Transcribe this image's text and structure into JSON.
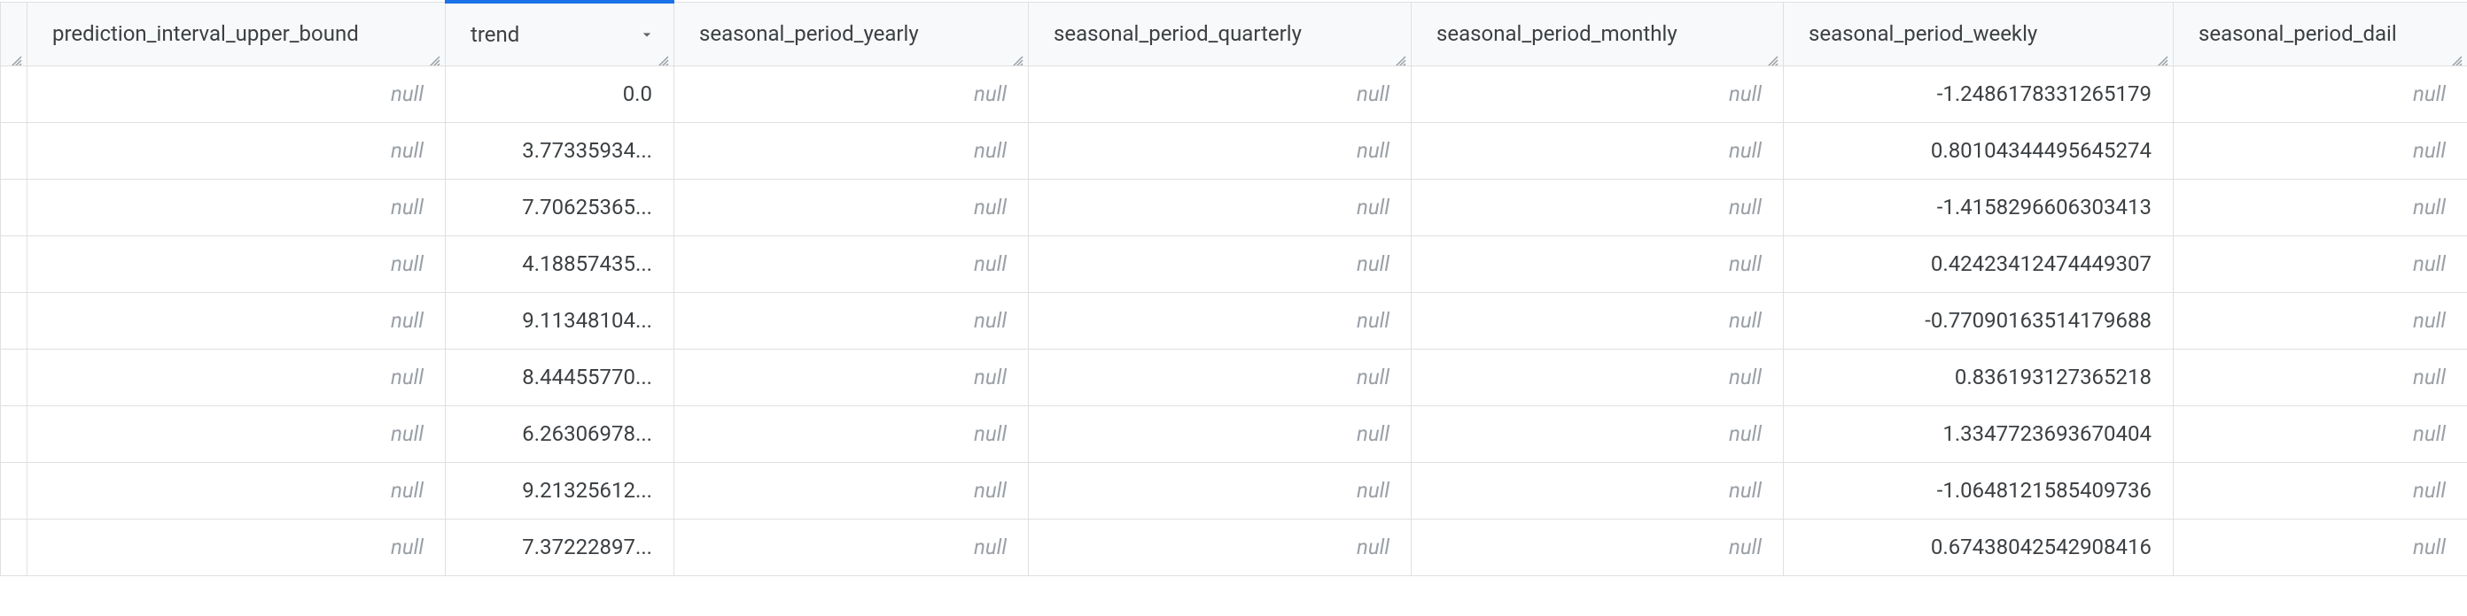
{
  "null_text": "null",
  "columns": [
    {
      "key": "prediction_interval_upper_bound",
      "label": "prediction_interval_upper_bound",
      "sorted": false
    },
    {
      "key": "trend",
      "label": "trend",
      "sorted": true,
      "sort_dir": "desc"
    },
    {
      "key": "seasonal_period_yearly",
      "label": "seasonal_period_yearly",
      "sorted": false
    },
    {
      "key": "seasonal_period_quarterly",
      "label": "seasonal_period_quarterly",
      "sorted": false
    },
    {
      "key": "seasonal_period_monthly",
      "label": "seasonal_period_monthly",
      "sorted": false
    },
    {
      "key": "seasonal_period_weekly",
      "label": "seasonal_period_weekly",
      "sorted": false
    },
    {
      "key": "seasonal_period_daily",
      "label": "seasonal_period_dail",
      "sorted": false
    }
  ],
  "rows": [
    {
      "prediction_interval_upper_bound": null,
      "trend": "0.0",
      "seasonal_period_yearly": null,
      "seasonal_period_quarterly": null,
      "seasonal_period_monthly": null,
      "seasonal_period_weekly": "-1.2486178331265179",
      "seasonal_period_daily": null
    },
    {
      "prediction_interval_upper_bound": null,
      "trend": "3.77335934...",
      "seasonal_period_yearly": null,
      "seasonal_period_quarterly": null,
      "seasonal_period_monthly": null,
      "seasonal_period_weekly": "0.80104344495645274",
      "seasonal_period_daily": null
    },
    {
      "prediction_interval_upper_bound": null,
      "trend": "7.70625365...",
      "seasonal_period_yearly": null,
      "seasonal_period_quarterly": null,
      "seasonal_period_monthly": null,
      "seasonal_period_weekly": "-1.4158296606303413",
      "seasonal_period_daily": null
    },
    {
      "prediction_interval_upper_bound": null,
      "trend": "4.18857435...",
      "seasonal_period_yearly": null,
      "seasonal_period_quarterly": null,
      "seasonal_period_monthly": null,
      "seasonal_period_weekly": "0.42423412474449307",
      "seasonal_period_daily": null
    },
    {
      "prediction_interval_upper_bound": null,
      "trend": "9.11348104...",
      "seasonal_period_yearly": null,
      "seasonal_period_quarterly": null,
      "seasonal_period_monthly": null,
      "seasonal_period_weekly": "-0.77090163514179688",
      "seasonal_period_daily": null
    },
    {
      "prediction_interval_upper_bound": null,
      "trend": "8.44455770...",
      "seasonal_period_yearly": null,
      "seasonal_period_quarterly": null,
      "seasonal_period_monthly": null,
      "seasonal_period_weekly": "0.836193127365218",
      "seasonal_period_daily": null
    },
    {
      "prediction_interval_upper_bound": null,
      "trend": "6.26306978...",
      "seasonal_period_yearly": null,
      "seasonal_period_quarterly": null,
      "seasonal_period_monthly": null,
      "seasonal_period_weekly": "1.3347723693670404",
      "seasonal_period_daily": null
    },
    {
      "prediction_interval_upper_bound": null,
      "trend": "9.21325612...",
      "seasonal_period_yearly": null,
      "seasonal_period_quarterly": null,
      "seasonal_period_monthly": null,
      "seasonal_period_weekly": "-1.0648121585409736",
      "seasonal_period_daily": null
    },
    {
      "prediction_interval_upper_bound": null,
      "trend": "7.37222897...",
      "seasonal_period_yearly": null,
      "seasonal_period_quarterly": null,
      "seasonal_period_monthly": null,
      "seasonal_period_weekly": "0.67438042542908416",
      "seasonal_period_daily": null
    }
  ]
}
